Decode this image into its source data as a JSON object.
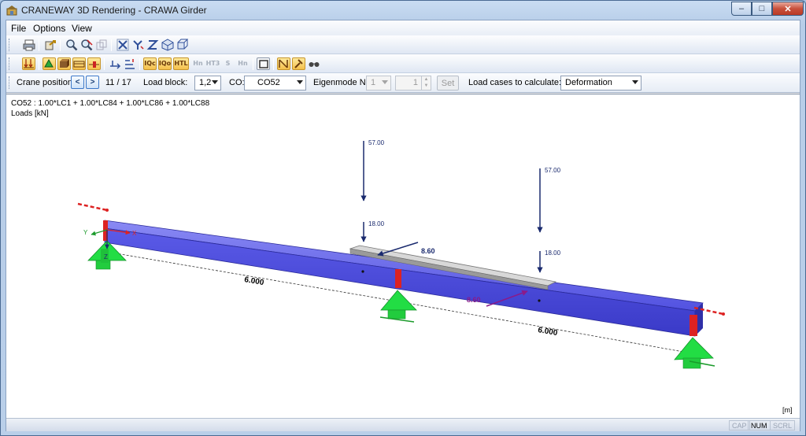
{
  "window": {
    "title": "CRANEWAY 3D Rendering - CRAWA Girder",
    "controls": {
      "minimize": "–",
      "maximize": "□",
      "close": "✕"
    }
  },
  "menu": [
    "File",
    "Options",
    "View"
  ],
  "toolbar1": [
    "print-icon",
    "export-icon",
    "zoom-icon",
    "zoom-reset-icon",
    "copy-view-icon",
    "view-x-icon",
    "view-neg-y-icon",
    "view-z-icon",
    "isometric-icon",
    "perspective-icon"
  ],
  "toolbar2": [
    "show-loads-icon",
    "show-supports-icon",
    "render-solid-icon",
    "render-wire-icon",
    "show-results-icon",
    "member-axes-icon",
    "sections-icon",
    "value-label-1",
    "value-label-2",
    "value-label-3",
    "value-label-4",
    "value-label-5",
    "value-label-6",
    "value-label-7",
    "frame-icon",
    "active-display-icon",
    "pin-icon",
    "glasses-icon"
  ],
  "toolbar2_labels": {
    "value_label_1": "IQc",
    "value_label_2": "IQo",
    "value_label_3": "HTL",
    "value_label_4": "Hn",
    "value_label_5": "HT3",
    "value_label_6": "S",
    "value_label_7": "Hn"
  },
  "controls": {
    "crane_position_label": "Crane position:",
    "prev": "<",
    "next": ">",
    "position_value": "11 / 17",
    "load_block_label": "Load block:",
    "load_block_value": "1,2",
    "co_label": "CO:",
    "co_value": "CO52",
    "eigenmode_label": "Eigenmode No.",
    "eigenmode_value": "1",
    "eigenmode_spin_value": "1",
    "set_button": "Set",
    "load_cases_label": "Load cases to calculate:",
    "load_cases_value": "Deformation"
  },
  "viewport": {
    "combination_text": "CO52 : 1.00*LC1 + 1.00*LC84 + 1.00*LC86 + 1.00*LC88",
    "loads_text": "Loads [kN]",
    "unit": "[m]",
    "load_values": {
      "v1": "57.00",
      "v2": "18.00",
      "v3": "57.00",
      "v4": "18.00",
      "h1": "8.60",
      "h2": "8.60"
    },
    "dimensions": {
      "span1": "6.000",
      "span2": "6.000"
    },
    "axes": {
      "x": "X",
      "y": "Y",
      "z": "Z"
    },
    "colors": {
      "beam": "#5b5be8",
      "support": "#22dd44",
      "stiffener": "#dd2222",
      "load": "#1a2a6e",
      "horizontal_load_2": "#8a1a8a"
    }
  },
  "status": {
    "cap": "CAP",
    "num": "NUM",
    "scrl": "SCRL"
  }
}
